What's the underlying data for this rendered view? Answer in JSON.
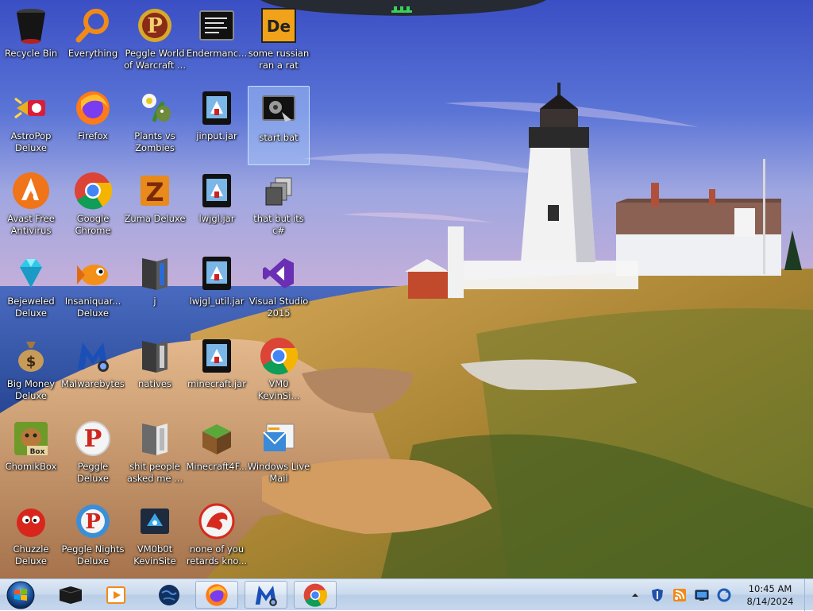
{
  "desktop": {
    "icons": [
      {
        "label": "Recycle Bin",
        "icon": "recycle-bin-icon"
      },
      {
        "label": "Everything",
        "icon": "search-magnifier-icon"
      },
      {
        "label": "Peggle World\nof Warcraft ...",
        "icon": "peggle-icon"
      },
      {
        "label": "Endermanc...",
        "icon": "terminal-icon"
      },
      {
        "label": "some russian\nran a rat",
        "icon": "de-app-icon"
      },
      {
        "label": "AstroPop\nDeluxe",
        "icon": "astropop-icon"
      },
      {
        "label": "Firefox",
        "icon": "firefox-icon"
      },
      {
        "label": "Plants vs\nZombies",
        "icon": "plants-vs-zombies-icon"
      },
      {
        "label": "jinput.jar",
        "icon": "java-jar-icon"
      },
      {
        "label": "start.bat",
        "icon": "batch-file-icon"
      },
      {
        "label": "Avast Free\nAntivirus",
        "icon": "avast-icon"
      },
      {
        "label": "Google\nChrome",
        "icon": "chrome-icon"
      },
      {
        "label": "Zuma Deluxe",
        "icon": "zuma-icon"
      },
      {
        "label": "lwjgl.jar",
        "icon": "java-jar-icon"
      },
      {
        "label": "that but its c#",
        "icon": "shortcut-stack-icon"
      },
      {
        "label": "Bejeweled\nDeluxe",
        "icon": "gem-icon"
      },
      {
        "label": "Insaniquar...\nDeluxe",
        "icon": "goldfish-icon"
      },
      {
        "label": "j",
        "icon": "folder-dark-icon"
      },
      {
        "label": "lwjgl_util.jar",
        "icon": "java-jar-icon"
      },
      {
        "label": "Visual Studio\n2015",
        "icon": "visual-studio-icon"
      },
      {
        "label": "Big Money\nDeluxe",
        "icon": "money-bag-icon"
      },
      {
        "label": "Malwarebytes",
        "icon": "malwarebytes-icon"
      },
      {
        "label": "natives",
        "icon": "folder-dark-icon"
      },
      {
        "label": "minecraft.jar",
        "icon": "java-jar-icon"
      },
      {
        "label": "VM0\nKevinSi...",
        "icon": "chrome-icon"
      },
      {
        "label": "ChomikBox",
        "icon": "chomikbox-icon"
      },
      {
        "label": "Peggle Deluxe",
        "icon": "peggle-icon"
      },
      {
        "label": "shit people\nasked me ...",
        "icon": "folder-dark-icon"
      },
      {
        "label": "Minecraft4F...",
        "icon": "minecraft-block-icon"
      },
      {
        "label": "Windows Live\nMail",
        "icon": "live-mail-icon"
      },
      {
        "label": "Chuzzle\nDeluxe",
        "icon": "chuzzle-icon"
      },
      {
        "label": "Peggle Nights\nDeluxe",
        "icon": "peggle-icon"
      },
      {
        "label": "VM0b0t\nKevinSite",
        "icon": "vm-app-icon"
      },
      {
        "label": "none of you\nretards kno...",
        "icon": "red-dragon-icon"
      }
    ]
  },
  "taskbar": {
    "start": {
      "icon": "windows-start-orb-icon"
    },
    "items": [
      {
        "name": "command-prompt",
        "icon": "terminal-icon",
        "running": false
      },
      {
        "name": "media-player",
        "icon": "media-player-icon",
        "running": false
      },
      {
        "name": "globe-app",
        "icon": "globe-icon",
        "running": false
      },
      {
        "name": "firefox",
        "icon": "firefox-icon",
        "running": true
      },
      {
        "name": "malwarebytes",
        "icon": "malwarebytes-icon",
        "running": true
      },
      {
        "name": "chrome",
        "icon": "chrome-icon",
        "running": true
      }
    ],
    "tray": {
      "icons": [
        "show-hidden-icons-chevron",
        "defender-shield-icon",
        "rss-feed-icon",
        "network-monitor-icon",
        "sync-icon"
      ],
      "time": "10:45 AM",
      "date": "8/14/2024"
    }
  },
  "colors": {
    "taskbar_bg": "#c9d9ec",
    "sky_top": "#3f55c8",
    "sky_bottom": "#c8a8d8",
    "sea": "#2d58a8",
    "grass": "#c89a3c"
  }
}
